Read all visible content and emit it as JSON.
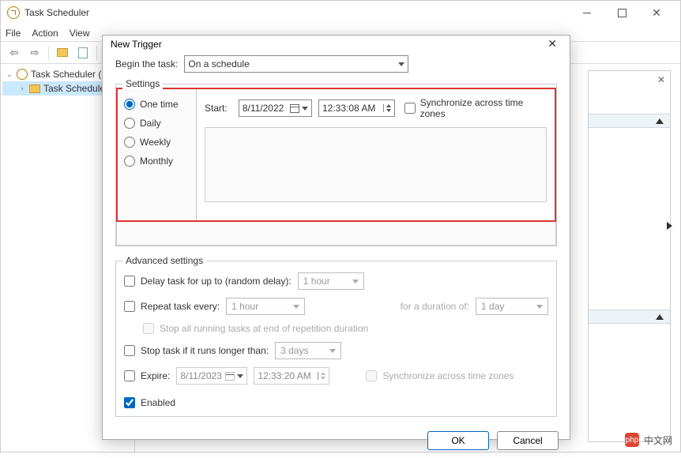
{
  "window": {
    "title": "Task Scheduler",
    "menu": {
      "file": "File",
      "action": "Action",
      "view": "View"
    }
  },
  "tree": {
    "root": "Task Scheduler (L",
    "child": "Task Schedule"
  },
  "dialog": {
    "title": "New Trigger",
    "begin_label": "Begin the task:",
    "begin_value": "On a schedule",
    "settings_label": "Settings",
    "freq": {
      "one_time": "One time",
      "daily": "Daily",
      "weekly": "Weekly",
      "monthly": "Monthly"
    },
    "start_label": "Start:",
    "start_date": "8/11/2022",
    "start_time": "12:33:08 AM",
    "sync_label": "Synchronize across time zones",
    "advanced_label": "Advanced settings",
    "delay_label": "Delay task for up to (random delay):",
    "delay_value": "1 hour",
    "repeat_label": "Repeat task every:",
    "repeat_value": "1 hour",
    "duration_label": "for a duration of:",
    "duration_value": "1 day",
    "stop_running_label": "Stop all running tasks at end of repetition duration",
    "stop_if_label": "Stop task if it runs longer than:",
    "stop_if_value": "3 days",
    "expire_label": "Expire:",
    "expire_date": "8/11/2023",
    "expire_time": "12:33:20 AM",
    "expire_sync_label": "Synchronize across time zones",
    "enabled_label": "Enabled",
    "ok": "OK",
    "cancel": "Cancel"
  },
  "watermark": {
    "logo": "php",
    "text": "中文网"
  }
}
